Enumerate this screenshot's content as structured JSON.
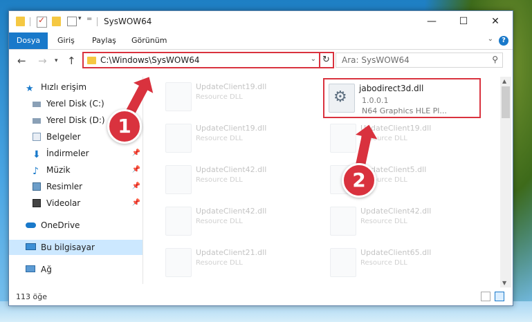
{
  "window": {
    "title": "SysWOW64",
    "controls": {
      "minimize": "—",
      "maximize": "☐",
      "close": "✕"
    }
  },
  "ribbon": {
    "tabs": [
      "Dosya",
      "Giriş",
      "Paylaş",
      "Görünüm"
    ],
    "help": "?"
  },
  "address": {
    "path": "C:\\Windows\\SysWOW64",
    "search_placeholder": "Ara: SysWOW64"
  },
  "sidebar": {
    "items": [
      {
        "label": "Hızlı erişim",
        "icon": "star-icon"
      },
      {
        "label": "Yerel Disk (C:)",
        "icon": "drive-icon"
      },
      {
        "label": "Yerel Disk (D:)",
        "icon": "drive-icon"
      },
      {
        "label": "Belgeler",
        "icon": "documents-icon"
      },
      {
        "label": "İndirmeler",
        "icon": "downloads-icon"
      },
      {
        "label": "Müzik",
        "icon": "music-icon"
      },
      {
        "label": "Resimler",
        "icon": "pictures-icon"
      },
      {
        "label": "Videolar",
        "icon": "videos-icon"
      },
      {
        "label": "OneDrive",
        "icon": "cloud-icon"
      },
      {
        "label": "Bu bilgisayar",
        "icon": "computer-icon"
      },
      {
        "label": "Ağ",
        "icon": "network-icon"
      }
    ]
  },
  "files": {
    "highlighted": {
      "name": "jabodirect3d.dll",
      "version": "1.0.0.1",
      "description": "N64 Graphics HLE Pl..."
    },
    "background": [
      {
        "name": "UpdateClient19.dll",
        "type": "Resource DLL"
      },
      {
        "name": "UpdateClient19.dll",
        "type": "Resource DLL"
      },
      {
        "name": "UpdateClient19.dll",
        "type": "Resource DLL"
      },
      {
        "name": "UpdateClient42.dll",
        "type": "Resource DLL"
      },
      {
        "name": "UpdateClient5.dll",
        "type": "Resource DLL"
      },
      {
        "name": "UpdateClient42.dll",
        "type": "Resource DLL"
      },
      {
        "name": "UpdateClient42.dll",
        "type": "Resource DLL"
      },
      {
        "name": "UpdateClient21.dll",
        "type": "Resource DLL"
      },
      {
        "name": "UpdateClient65.dll",
        "type": "Resource DLL"
      }
    ]
  },
  "status": {
    "item_count": "113 öğe"
  },
  "annotations": {
    "step1": "1",
    "step2": "2"
  },
  "colors": {
    "accent": "#1979ca",
    "highlight": "#d9323e",
    "selected": "#cce8ff"
  }
}
